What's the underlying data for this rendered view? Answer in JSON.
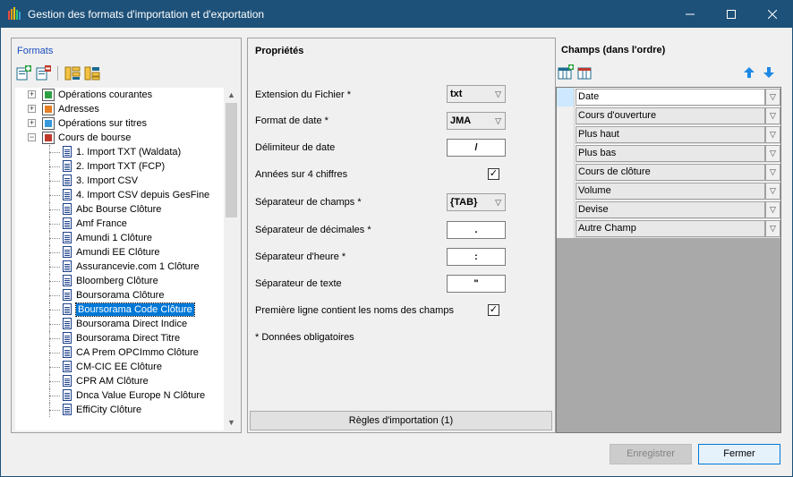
{
  "window": {
    "title": "Gestion des formats d'importation et d'exportation"
  },
  "left": {
    "header": "Formats",
    "tree": [
      {
        "label": "Opérations courantes",
        "level": 0,
        "expander": "+",
        "icon": "chart-icon"
      },
      {
        "label": "Adresses",
        "level": 0,
        "expander": "+",
        "icon": "address-icon"
      },
      {
        "label": "Opérations sur titres",
        "level": 0,
        "expander": "+",
        "icon": "securities-icon"
      },
      {
        "label": "Cours de bourse",
        "level": 0,
        "expander": "−",
        "icon": "stock-chart-icon"
      },
      {
        "label": "1. Import TXT (Waldata)",
        "level": 1
      },
      {
        "label": "2. Import TXT (FCP)",
        "level": 1
      },
      {
        "label": "3. Import CSV",
        "level": 1
      },
      {
        "label": "4. Import CSV depuis GesFine",
        "level": 1
      },
      {
        "label": "Abc Bourse Clôture",
        "level": 1
      },
      {
        "label": "Amf France",
        "level": 1
      },
      {
        "label": "Amundi 1 Clôture",
        "level": 1
      },
      {
        "label": "Amundi EE Clôture",
        "level": 1
      },
      {
        "label": "Assurancevie.com 1 Clôture",
        "level": 1
      },
      {
        "label": "Bloomberg Clôture",
        "level": 1
      },
      {
        "label": "Boursorama Clôture",
        "level": 1
      },
      {
        "label": "Boursorama Code Clôture",
        "level": 1,
        "selected": true
      },
      {
        "label": "Boursorama Direct Indice",
        "level": 1
      },
      {
        "label": "Boursorama Direct Titre",
        "level": 1
      },
      {
        "label": "CA Prem OPCImmo Clôture",
        "level": 1
      },
      {
        "label": "CM-CIC EE Clôture",
        "level": 1
      },
      {
        "label": "CPR AM Clôture",
        "level": 1
      },
      {
        "label": "Dnca Value Europe N Clôture",
        "level": 1
      },
      {
        "label": "EffiCity Clôture",
        "level": 1
      }
    ]
  },
  "props": {
    "title": "Propriétés",
    "extension_label": "Extension du Fichier *",
    "extension_value": "txt",
    "date_format_label": "Format de date *",
    "date_format_value": "JMA",
    "date_delim_label": "Délimiteur de date",
    "date_delim_value": "/",
    "year4_label": "Années sur 4 chiffres",
    "year4_checked": true,
    "field_sep_label": "Séparateur de champs *",
    "field_sep_value": "{TAB}",
    "dec_sep_label": "Séparateur de décimales *",
    "dec_sep_value": ".",
    "time_sep_label": "Séparateur d'heure *",
    "time_sep_value": ":",
    "text_sep_label": "Séparateur de texte",
    "text_sep_value": "\"",
    "first_line_label": "Première ligne contient les noms des champs",
    "first_line_checked": true,
    "required_note": "* Données obligatoires",
    "rules_button": "Règles d'importation  (1)"
  },
  "fields": {
    "title": "Champs (dans l'ordre)",
    "rows": [
      "Date",
      "Cours d'ouverture",
      "Plus haut",
      "Plus bas",
      "Cours de clôture",
      "Volume",
      "Devise",
      "Autre Champ"
    ]
  },
  "buttons": {
    "save": "Enregistrer",
    "close": "Fermer"
  }
}
